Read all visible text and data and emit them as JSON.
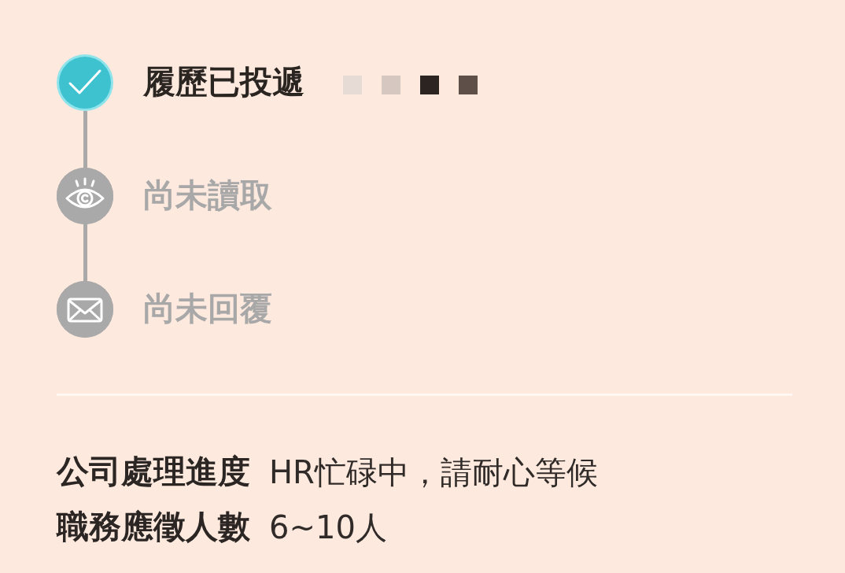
{
  "steps": [
    {
      "kind": "check",
      "label": "履歷已投遞",
      "done": true,
      "mosaic": true
    },
    {
      "kind": "eye",
      "label": "尚未讀取",
      "done": false,
      "mosaic": false
    },
    {
      "kind": "mail",
      "label": "尚未回覆",
      "done": false,
      "mosaic": false
    }
  ],
  "details": [
    {
      "label": "公司處理進度",
      "value": "HR忙碌中，請耐心等候"
    },
    {
      "label": "職務應徵人數",
      "value": "6~10人"
    }
  ]
}
